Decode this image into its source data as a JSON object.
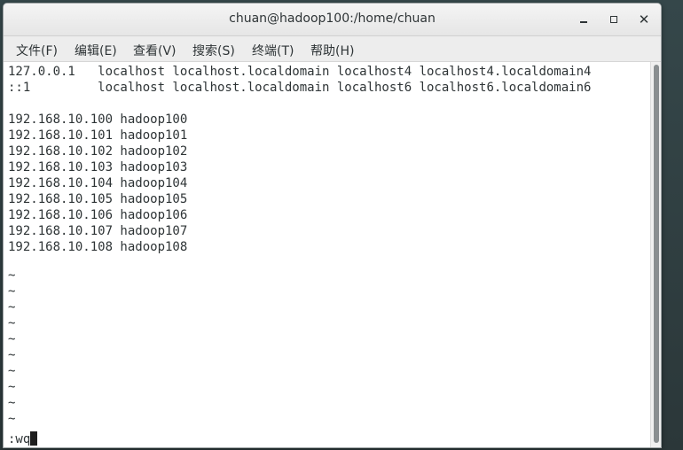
{
  "window": {
    "title": "chuan@hadoop100:/home/chuan"
  },
  "menubar": {
    "items": [
      {
        "label": "文件(F)"
      },
      {
        "label": "编辑(E)"
      },
      {
        "label": "查看(V)"
      },
      {
        "label": "搜索(S)"
      },
      {
        "label": "终端(T)"
      },
      {
        "label": "帮助(H)"
      }
    ]
  },
  "terminal": {
    "lines": [
      "127.0.0.1   localhost localhost.localdomain localhost4 localhost4.localdomain4",
      "::1         localhost localhost.localdomain localhost6 localhost6.localdomain6",
      "",
      "192.168.10.100 hadoop100",
      "192.168.10.101 hadoop101",
      "192.168.10.102 hadoop102",
      "192.168.10.103 hadoop103",
      "192.168.10.104 hadoop104",
      "192.168.10.105 hadoop105",
      "192.168.10.106 hadoop106",
      "192.168.10.107 hadoop107",
      "192.168.10.108 hadoop108",
      "",
      "~",
      "~",
      "~",
      "~",
      "~",
      "~",
      "~",
      "~",
      "~",
      "~"
    ],
    "command_line": ":wq"
  }
}
